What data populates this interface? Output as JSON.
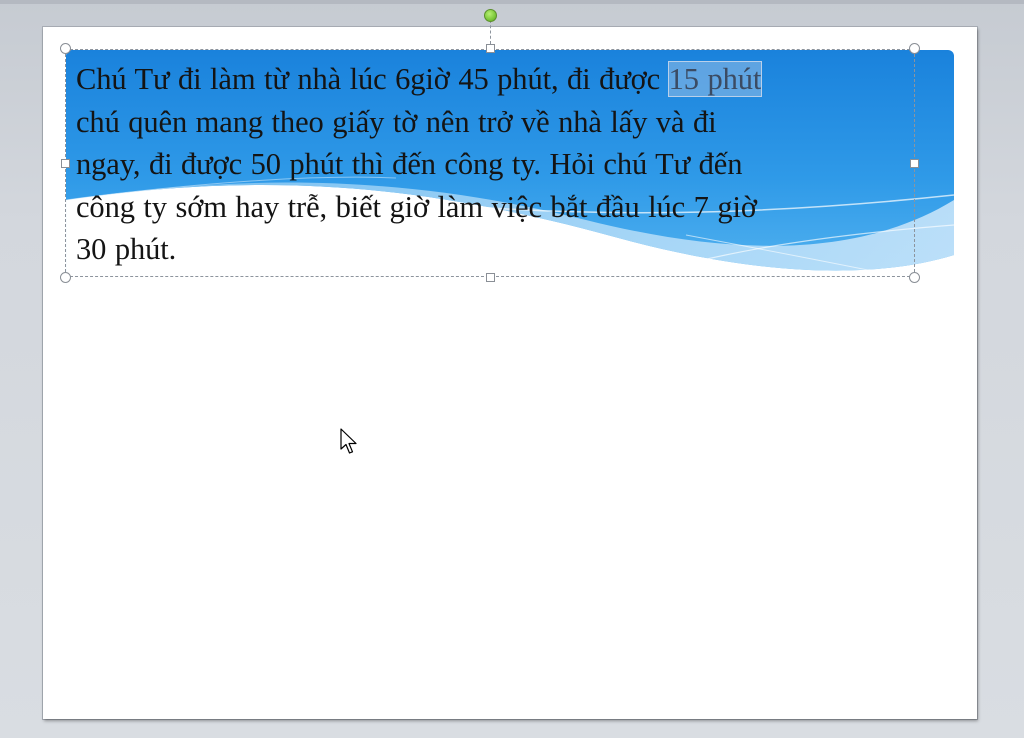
{
  "slide": {
    "textbox": {
      "lines": [
        {
          "text": "Chú Tư đi làm từ nhà lúc 6giờ 45 phút, đi được ",
          "selected": "15 phút"
        },
        {
          "text": "chú quên mang theo giấy tờ nên trở về nhà lấy và đi"
        },
        {
          "text": "ngay, đi được 50 phút thì đến công ty. Hỏi chú Tư đến"
        },
        {
          "text": "công ty sớm hay trễ, biết giờ làm việc bắt đầu lúc 7 giờ"
        },
        {
          "text": "30 phút."
        }
      ]
    }
  },
  "icons": {
    "cursor": "mouse-pointer-icon",
    "rotate": "rotate-handle-icon"
  },
  "colors": {
    "banner_top": "#1b86dd",
    "banner_light": "#9fd3f5",
    "selection_handle": "#ffffff",
    "rotate_handle": "#7cc83a"
  }
}
